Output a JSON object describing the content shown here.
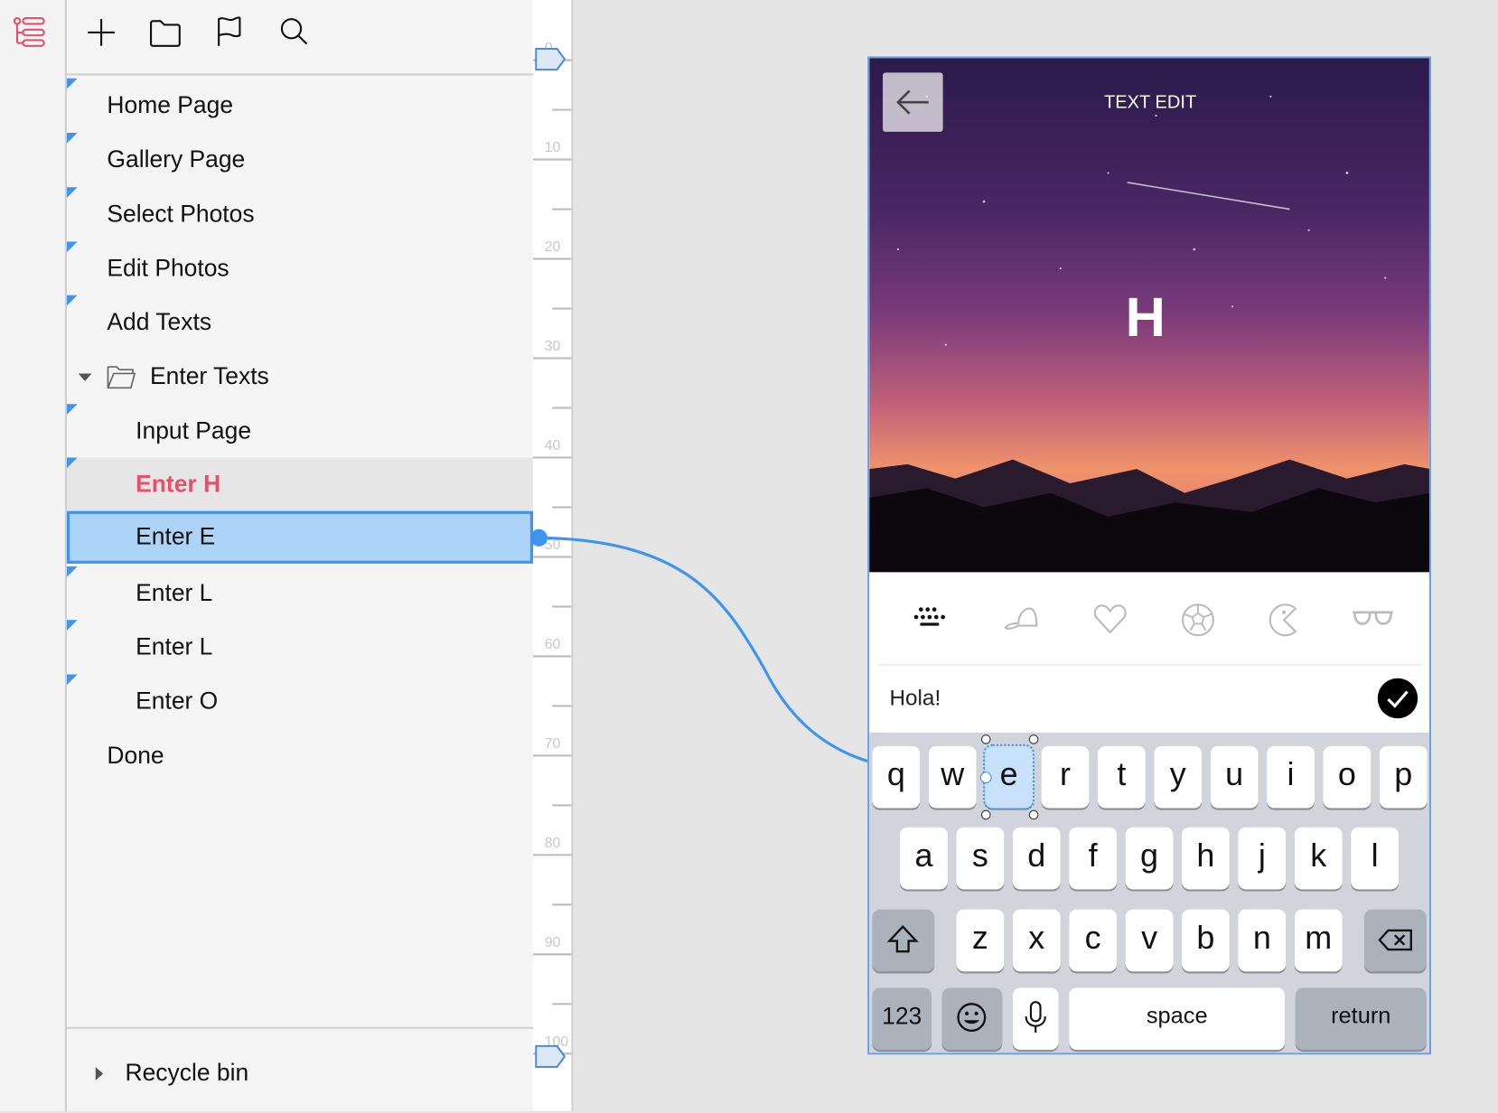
{
  "toolbar": {
    "icons": [
      "outline-tree-icon",
      "plus-icon",
      "folder-icon",
      "flag-icon",
      "search-icon"
    ]
  },
  "tree": {
    "items": [
      {
        "label": "Home Page",
        "level": 0
      },
      {
        "label": "Gallery Page",
        "level": 0
      },
      {
        "label": "Select Photos",
        "level": 0
      },
      {
        "label": "Edit Photos",
        "level": 0
      },
      {
        "label": "Add Texts",
        "level": 0
      },
      {
        "label": "Enter Texts",
        "level": 0,
        "folder": true,
        "expanded": true
      },
      {
        "label": "Input Page",
        "level": 1
      },
      {
        "label": "Enter H",
        "level": 1,
        "state": "current"
      },
      {
        "label": "Enter E",
        "level": 1,
        "state": "selected"
      },
      {
        "label": "Enter L",
        "level": 1
      },
      {
        "label": "Enter L",
        "level": 1
      },
      {
        "label": "Enter O",
        "level": 1
      },
      {
        "label": "Done",
        "level": 0
      }
    ],
    "recycle_bin": "Recycle bin"
  },
  "ruler": {
    "labels": [
      "0",
      "10",
      "20",
      "30",
      "40",
      "50",
      "60",
      "70",
      "80",
      "90",
      "100"
    ]
  },
  "phone": {
    "title": "TEXT EDIT",
    "big_letter": "H",
    "emoji_tabs": [
      "keyboard-icon",
      "cap-icon",
      "heart-icon",
      "soccer-ball-icon",
      "pacman-icon",
      "glasses-icon"
    ],
    "input_value": "Hola!",
    "keyboard": {
      "row1": [
        "q",
        "w",
        "e",
        "r",
        "t",
        "y",
        "u",
        "i",
        "o",
        "p"
      ],
      "row2": [
        "a",
        "s",
        "d",
        "f",
        "g",
        "h",
        "j",
        "k",
        "l"
      ],
      "row3": [
        "z",
        "x",
        "c",
        "v",
        "b",
        "n",
        "m"
      ],
      "numbers": "123",
      "space": "space",
      "return": "return"
    }
  },
  "colors": {
    "accent": "#3d95f0",
    "current": "#e8506a",
    "selected_bg": "#add3f7"
  }
}
